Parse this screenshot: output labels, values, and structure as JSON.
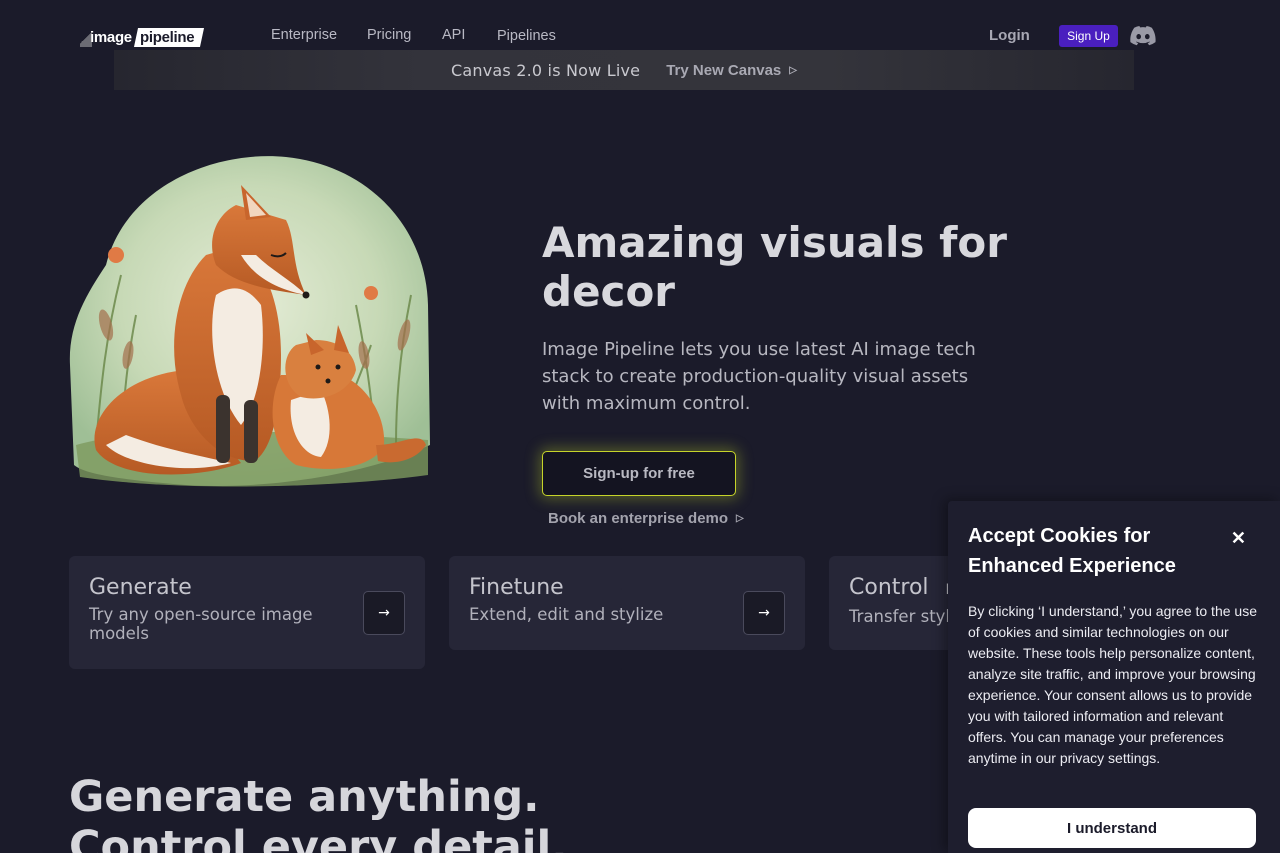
{
  "nav": {
    "logo_word1": "image",
    "logo_word2": "pipeline",
    "links": [
      "Enterprise",
      "Pricing",
      "API",
      "Pipelines"
    ],
    "login": "Login",
    "signup": "Sign Up",
    "discord_icon": "discord-icon",
    "signup_color": "#4a1fbf"
  },
  "banner": {
    "text": "Canvas 2.0 is Now Live",
    "cta": "Try New Canvas",
    "cta_icon": "▷"
  },
  "hero": {
    "title": "Amazing visuals for decor",
    "subtitle": "Image Pipeline lets you use latest AI image tech stack to create production-quality visual assets with maximum control.",
    "primary_cta": "Sign-up for free",
    "secondary_cta": "Book an enterprise demo",
    "secondary_icon": "▷",
    "image_subject": "watercolor fox with cub",
    "accent_color": "#c6d42a"
  },
  "cards": [
    {
      "title": "Generate",
      "desc": "Try any open-source image models",
      "icon": "arrow-right-icon"
    },
    {
      "title": "Finetune",
      "desc": "Extend, edit and stylize",
      "icon": "arrow-right-icon"
    },
    {
      "title": "Control",
      "desc": "Transfer styl",
      "badge": "N",
      "icon": "arrow-right-icon"
    }
  ],
  "section": {
    "line1": "Generate anything.",
    "line2": "Control every detail."
  },
  "cookie": {
    "title": "Accept Cookies for Enhanced Experience",
    "close": "✕",
    "body": "By clicking ‘I understand,’ you agree to the use of cookies and similar technologies on our website. These tools help personalize content, analyze site traffic, and improve your browsing experience. Your consent allows us to provide you with tailored information and relevant offers. You can manage your preferences anytime in our privacy settings.",
    "button": "I understand"
  }
}
